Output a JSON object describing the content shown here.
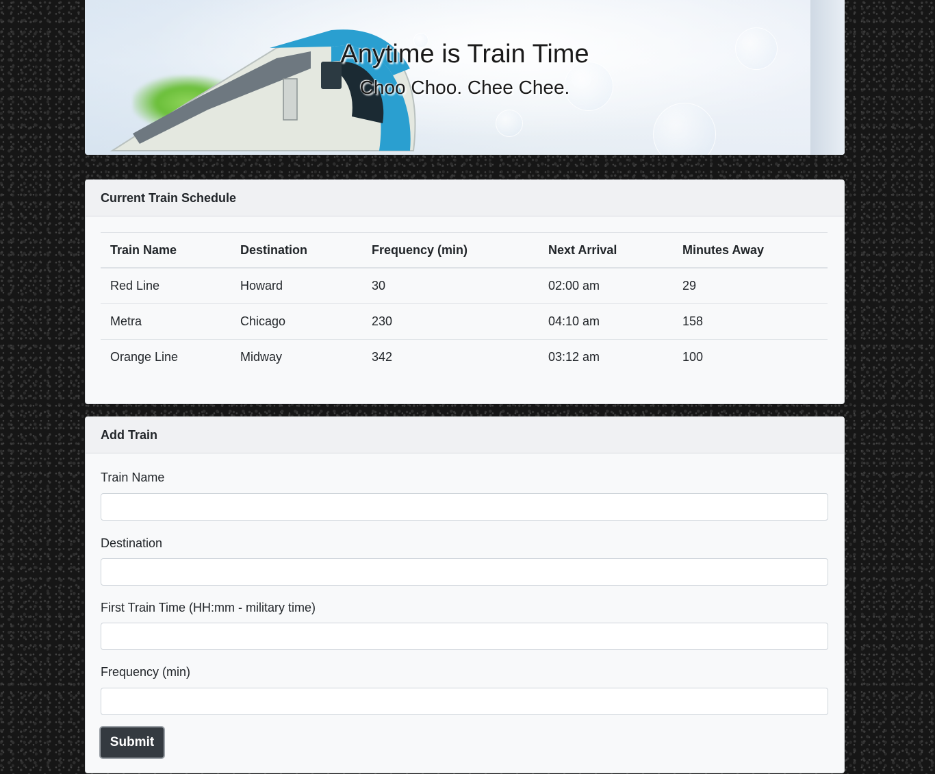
{
  "header": {
    "title": "Anytime is Train Time",
    "subtitle": "Choo Choo. Chee Chee."
  },
  "schedule": {
    "title": "Current Train Schedule",
    "columns": [
      "Train Name",
      "Destination",
      "Frequency (min)",
      "Next Arrival",
      "Minutes Away"
    ],
    "rows": [
      [
        "Red Line",
        "Howard",
        "30",
        "02:00 am",
        "29"
      ],
      [
        "Metra",
        "Chicago",
        "230",
        "04:10 am",
        "158"
      ],
      [
        "Orange Line",
        "Midway",
        "342",
        "03:12 am",
        "100"
      ]
    ]
  },
  "form": {
    "title": "Add Train",
    "fields": {
      "train_name": {
        "label": "Train Name",
        "value": ""
      },
      "destination": {
        "label": "Destination",
        "value": ""
      },
      "first_time": {
        "label": "First Train Time (HH:mm - military time)",
        "value": ""
      },
      "frequency": {
        "label": "Frequency (min)",
        "value": ""
      }
    },
    "submit_label": "Submit"
  },
  "colors": {
    "button_bg": "#343a40",
    "train_accent": "#2a9fd0"
  }
}
